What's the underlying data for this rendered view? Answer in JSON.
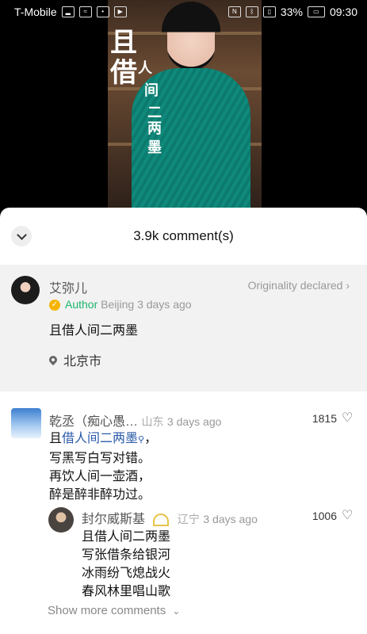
{
  "status_bar": {
    "carrier": "T-Mobile",
    "battery": "33%",
    "time": "09:30"
  },
  "video": {
    "title_chars": [
      "且",
      "借",
      "人",
      "间",
      "二",
      "两",
      "墨"
    ]
  },
  "sheet": {
    "count_label": "3.9k comment(s)"
  },
  "pinned": {
    "username": "艾弥儿",
    "originality": "Originality declared",
    "author_label": "Author",
    "location": "Beijing",
    "time": "3 days ago",
    "text": "且借人间二两墨",
    "place": "北京市"
  },
  "comment": {
    "username": "乾丞（痴心愚…",
    "location": "山东",
    "time": "3 days ago",
    "likes": "1815",
    "line1_prefix": "且",
    "line1_link": "借人间二两墨",
    "line1_suffix": "，",
    "line2": "写黑写白写对错。",
    "line3": "再饮人间一壶酒，",
    "line4": "醉是醉非醉功过。"
  },
  "reply": {
    "username": "封尔威斯基",
    "location": "辽宁",
    "time": "3 days ago",
    "likes": "1006",
    "line1": "且借人间二两墨",
    "line2": "写张借条给银河",
    "line3": "冰雨纷飞熄战火",
    "line4": "春风林里唱山歌"
  },
  "show_more": "Show more comments"
}
